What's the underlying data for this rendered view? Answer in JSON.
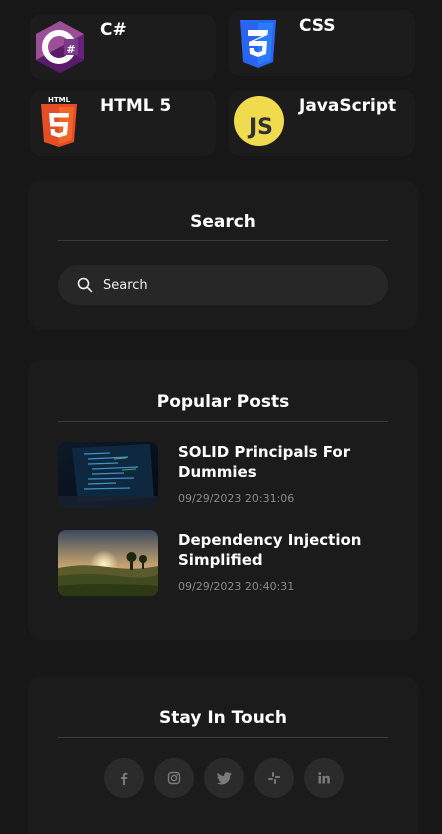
{
  "tags": [
    {
      "label": "C#",
      "icon": "csharp-logo-icon"
    },
    {
      "label": "CSS",
      "icon": "css3-logo-icon"
    },
    {
      "label": "HTML 5",
      "icon": "html5-logo-icon"
    },
    {
      "label": "JavaScript",
      "icon": "javascript-logo-icon"
    }
  ],
  "search": {
    "title": "Search",
    "placeholder": "Search",
    "icon": "search-icon"
  },
  "popular": {
    "title": "Popular Posts",
    "posts": [
      {
        "title": "SOLID Principals For Dummies",
        "date": "09/29/2023 20:31:06"
      },
      {
        "title": "Dependency Injection Simplified",
        "date": "09/29/2023 20:40:31"
      }
    ]
  },
  "stay": {
    "title": "Stay In Touch",
    "links": [
      {
        "icon": "facebook-icon",
        "glyph": "f"
      },
      {
        "icon": "instagram-icon",
        "glyph": "◎"
      },
      {
        "icon": "twitter-icon",
        "glyph": "🐦"
      },
      {
        "icon": "slack-icon",
        "glyph": "#"
      },
      {
        "icon": "linkedin-icon",
        "glyph": "in"
      }
    ]
  },
  "colors": {
    "background": "#171717",
    "card": "#1b1b1b",
    "csharp": "#682a7b",
    "css": "#2965f1",
    "html": "#e44d26",
    "js": "#f0db4f"
  }
}
